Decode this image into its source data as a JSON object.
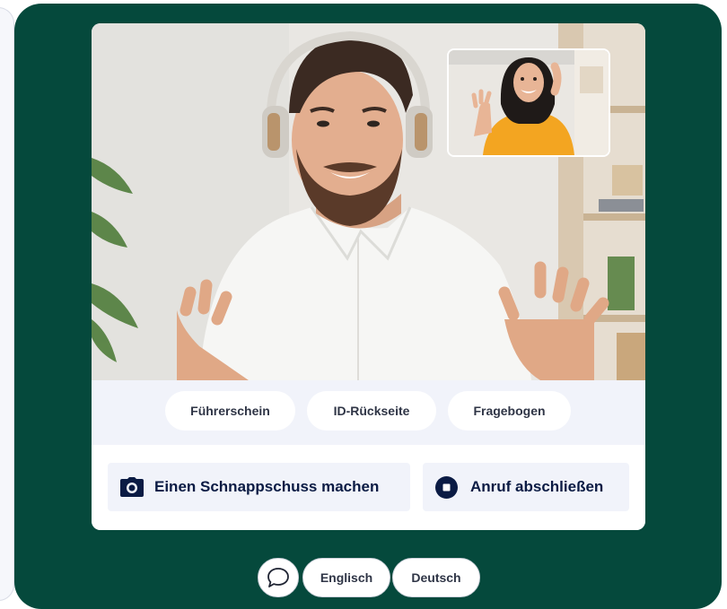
{
  "colors": {
    "stage_bg": "#05493c",
    "docbar_bg": "#f1f3fa",
    "action_text": "#0b1b44",
    "chip_text": "#2f3546"
  },
  "video": {
    "main_participant": "man-with-headphones",
    "self_view": "woman-waving"
  },
  "documents": {
    "items": [
      {
        "label": "Führerschein"
      },
      {
        "label": "ID-Rückseite"
      },
      {
        "label": "Fragebogen"
      }
    ]
  },
  "actions": {
    "snapshot": {
      "label": "Einen Schnappschuss machen",
      "icon": "camera-icon"
    },
    "end_call": {
      "label": "Anruf abschließen",
      "icon": "stop-icon"
    }
  },
  "bottom_bar": {
    "chat_icon": "chat-bubble-icon",
    "languages": [
      {
        "label": "Englisch"
      },
      {
        "label": "Deutsch"
      }
    ]
  }
}
